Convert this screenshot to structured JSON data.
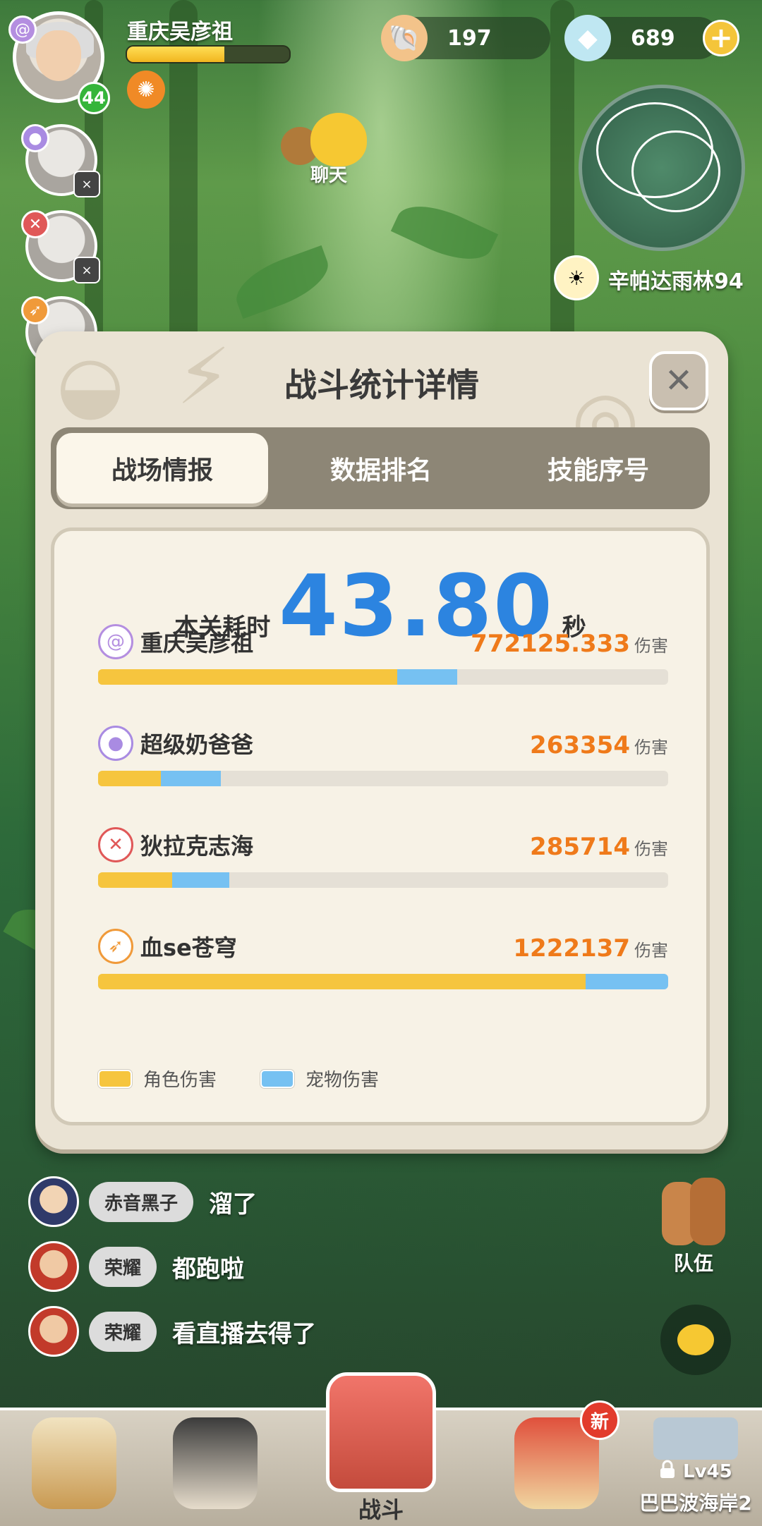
{
  "hud": {
    "player_name": "重庆吴彦祖",
    "level": "44",
    "xp_fraction": 0.6,
    "currency1": "197",
    "currency2": "689",
    "chat_label": "聊天",
    "location": "辛帕达雨林94"
  },
  "panel": {
    "title": "战斗统计详情",
    "tabs": [
      "战场情报",
      "数据排名",
      "技能序号"
    ],
    "active_tab": 0,
    "time_label": "本关耗时",
    "time_value": "43.80",
    "time_unit": "秒",
    "damage_unit": "伤害",
    "players": [
      {
        "name": "重庆吴彦祖",
        "damage": "772125.333",
        "role_fraction": 0.525,
        "pet_fraction": 0.105,
        "icon": "spiral-class-icon",
        "icon_color": "#b48ee0"
      },
      {
        "name": "超级奶爸爸",
        "damage": "263354",
        "role_fraction": 0.11,
        "pet_fraction": 0.105,
        "icon": "orb-class-icon",
        "icon_color": "#a98be2"
      },
      {
        "name": "狄拉克志海",
        "damage": "285714",
        "role_fraction": 0.13,
        "pet_fraction": 0.1,
        "icon": "crossed-swords-class-icon",
        "icon_color": "#e05858"
      },
      {
        "name": "血se苍穹",
        "damage": "1222137",
        "role_fraction": 0.855,
        "pet_fraction": 0.145,
        "icon": "sword-class-icon",
        "icon_color": "#f09a3a"
      }
    ],
    "legend": [
      {
        "label": "角色伤害",
        "color": "#f6c53e"
      },
      {
        "label": "宠物伤害",
        "color": "#76c1f2"
      }
    ]
  },
  "chat": [
    {
      "tag": "赤音黑子",
      "message": "溜了"
    },
    {
      "tag": "荣耀",
      "message": "都跑啦"
    },
    {
      "tag": "荣耀",
      "message": "看直播去得了"
    }
  ],
  "side": {
    "team_label": "队伍"
  },
  "nav": {
    "battle_label": "战斗",
    "new_badge": "新",
    "locked_level": "Lv45",
    "locked_name": "巴巴波海岸2"
  },
  "colors": {
    "accent_blue": "#2c84e0",
    "damage_orange": "#ef7a1a"
  }
}
